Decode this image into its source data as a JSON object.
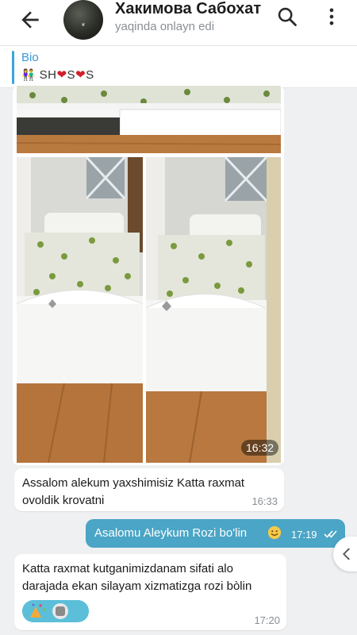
{
  "header": {
    "contact_name": "Хакимова Сабохат",
    "status": "yaqinda onlayn edi",
    "avatar_icon": "avatar-photo",
    "back_icon": "arrow-left-icon",
    "search_icon": "search-icon",
    "menu_icon": "more-vert-icon"
  },
  "bio": {
    "label": "Bio",
    "text_parts": [
      "SH",
      "S",
      "S"
    ],
    "heart_color": "#d21d2b"
  },
  "messages": {
    "photos_time": "16:32",
    "incoming_1": {
      "text": "Assalom alekum yaxshimisiz Katta raxmat ovoldik krovatni",
      "time": "16:33"
    },
    "outgoing_1": {
      "text": "Asalomu Aleykum Rozi bo'lin",
      "time": "17:19",
      "read": true
    },
    "incoming_2": {
      "text": "Katta raxmat kutganimizdanam sifati alo darajada ekan silayam xizmatizga rozi bòlin",
      "time": "17:20"
    }
  },
  "colors": {
    "accent": "#3a97d4",
    "outgoing_bubble": "#4aa5c6",
    "background": "#eef0f2"
  }
}
